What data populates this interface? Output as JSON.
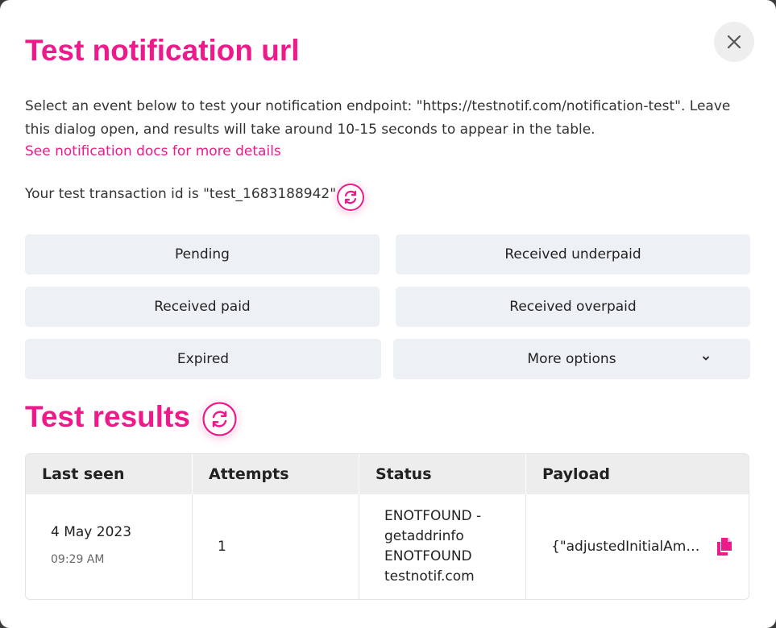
{
  "dialog": {
    "title": "Test notification url",
    "description": "Select an event below to test your notification endpoint: \"https://testnotif.com/notification-test\". Leave this dialog open, and results will take around 10-15 seconds to appear in the table.",
    "docs_link": "See notification docs for more details",
    "transaction_line": "Your test transaction id is \"test_1683188942\"",
    "close_icon": "close-icon",
    "refresh_icon": "refresh-icon"
  },
  "events": {
    "pending": "Pending",
    "received_underpaid": "Received underpaid",
    "received_paid": "Received paid",
    "received_overpaid": "Received overpaid",
    "expired": "Expired",
    "more_options": "More options"
  },
  "results": {
    "title": "Test results",
    "columns": [
      "Last seen",
      "Attempts",
      "Status",
      "Payload"
    ],
    "rows": [
      {
        "date": "4 May 2023",
        "time": "09:29 AM",
        "attempts": "1",
        "status": "ENOTFOUND - getaddrinfo ENOTFOUND testnotif.com",
        "payload": "{\"adjustedInitialAmount"
      }
    ]
  },
  "colors": {
    "accent": "#ef1a8a",
    "button_bg": "#edf1f5",
    "header_bg": "#ededed"
  }
}
